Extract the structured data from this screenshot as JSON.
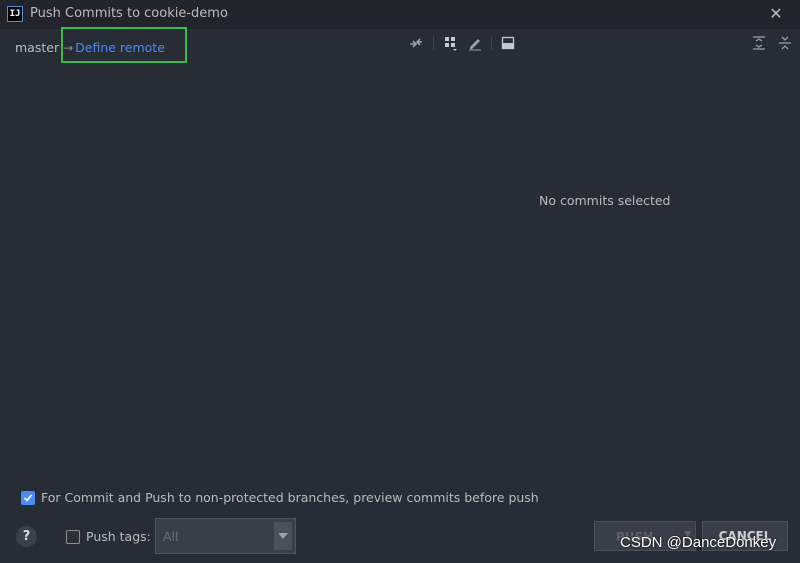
{
  "window": {
    "title": "Push Commits to cookie-demo",
    "app_icon_text": "IJ"
  },
  "branch": {
    "name": "master",
    "arrow": "→",
    "define_remote_label": "Define remote"
  },
  "details": {
    "empty_message": "No commits selected"
  },
  "options": {
    "preview_label": "For Commit and Push to non-protected branches, preview commits before push",
    "preview_checked": true,
    "push_tags_label": "Push tags:",
    "push_tags_checked": false,
    "tags_value": "All"
  },
  "buttons": {
    "push_label": "PUSH",
    "cancel_label": "CANCEL",
    "help_label": "?"
  },
  "watermark": "CSDN @DanceDonkey",
  "colors": {
    "background": "#282c34",
    "title_bar": "#21252b",
    "link": "#4a8cf7",
    "highlight_box": "#2fbf4a"
  }
}
